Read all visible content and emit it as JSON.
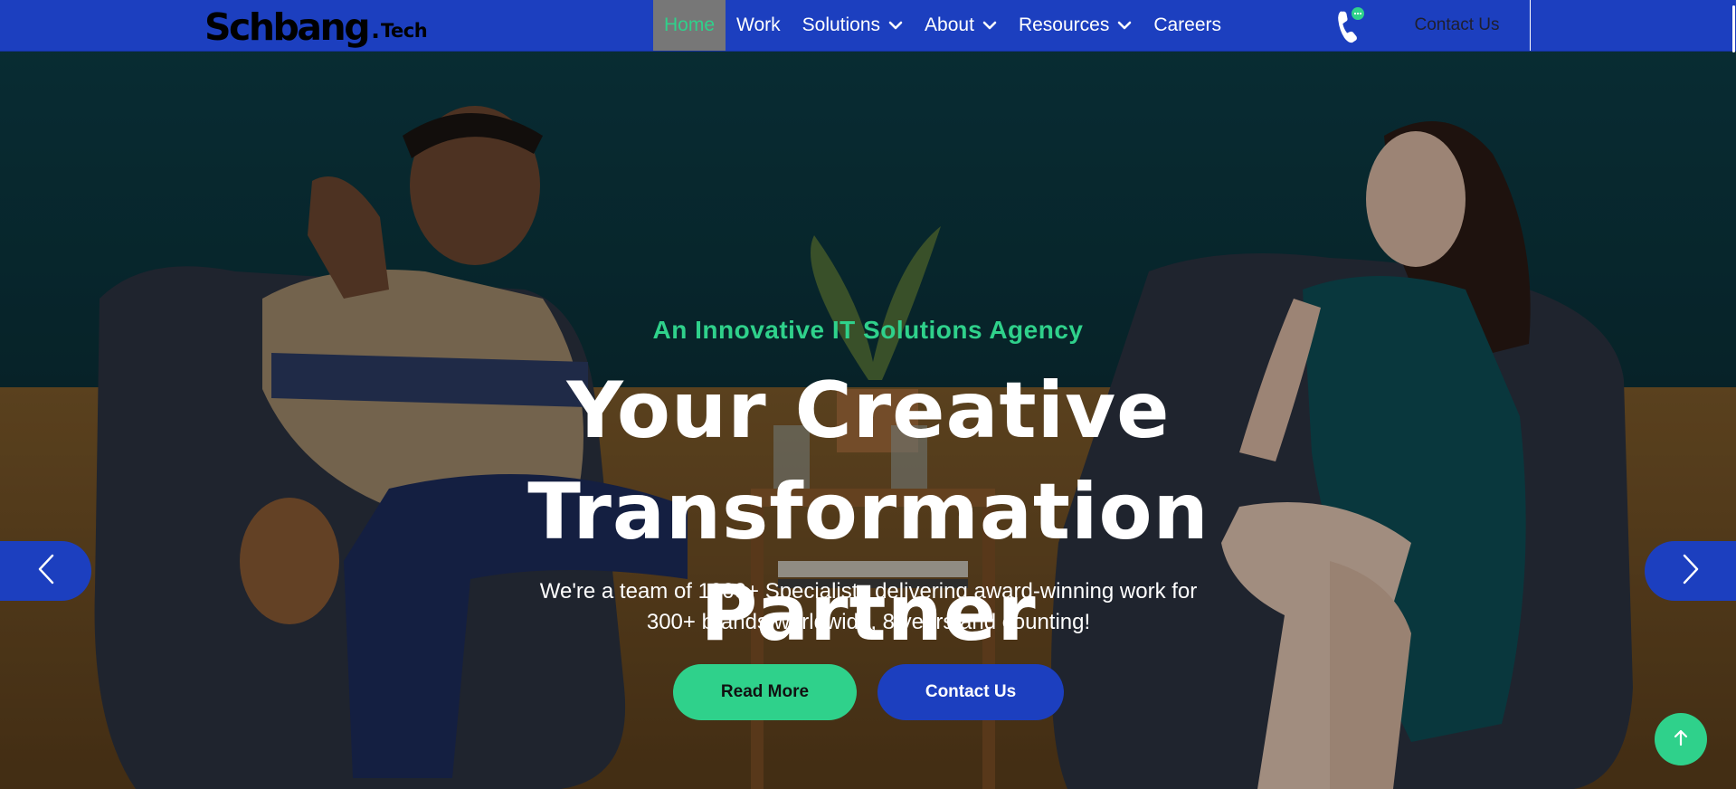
{
  "brand": {
    "name_main": "Schbang",
    "name_dot": ".",
    "name_suffix": "Tech"
  },
  "nav": {
    "items": [
      {
        "label": "Home",
        "active": true,
        "dropdown": false
      },
      {
        "label": "Work",
        "active": false,
        "dropdown": false
      },
      {
        "label": "Solutions",
        "active": false,
        "dropdown": true
      },
      {
        "label": "About",
        "active": false,
        "dropdown": true
      },
      {
        "label": "Resources",
        "active": false,
        "dropdown": true
      },
      {
        "label": "Careers",
        "active": false,
        "dropdown": false
      }
    ],
    "contact_label": "Contact Us",
    "phone_icon": "phone-chat-icon"
  },
  "hero": {
    "subtitle": "An Innovative IT Solutions Agency",
    "title_line1": "Your Creative Transformation",
    "title_line2": "Partner",
    "description_line1": "We're a team of 1000+ Specialists delivering award-winning work for",
    "description_line2": "300+ brands worldwide, 8 years and counting!",
    "primary_button": "Read More",
    "secondary_button": "Contact Us"
  },
  "slider": {
    "prev_icon": "chevron-left-icon",
    "next_icon": "chevron-right-icon"
  },
  "scroll_top_icon": "arrow-up-icon",
  "colors": {
    "primary_blue": "#1c3fbf",
    "accent_green": "#2fd18b",
    "active_nav_bg": "#777777",
    "text_white": "#ffffff"
  }
}
